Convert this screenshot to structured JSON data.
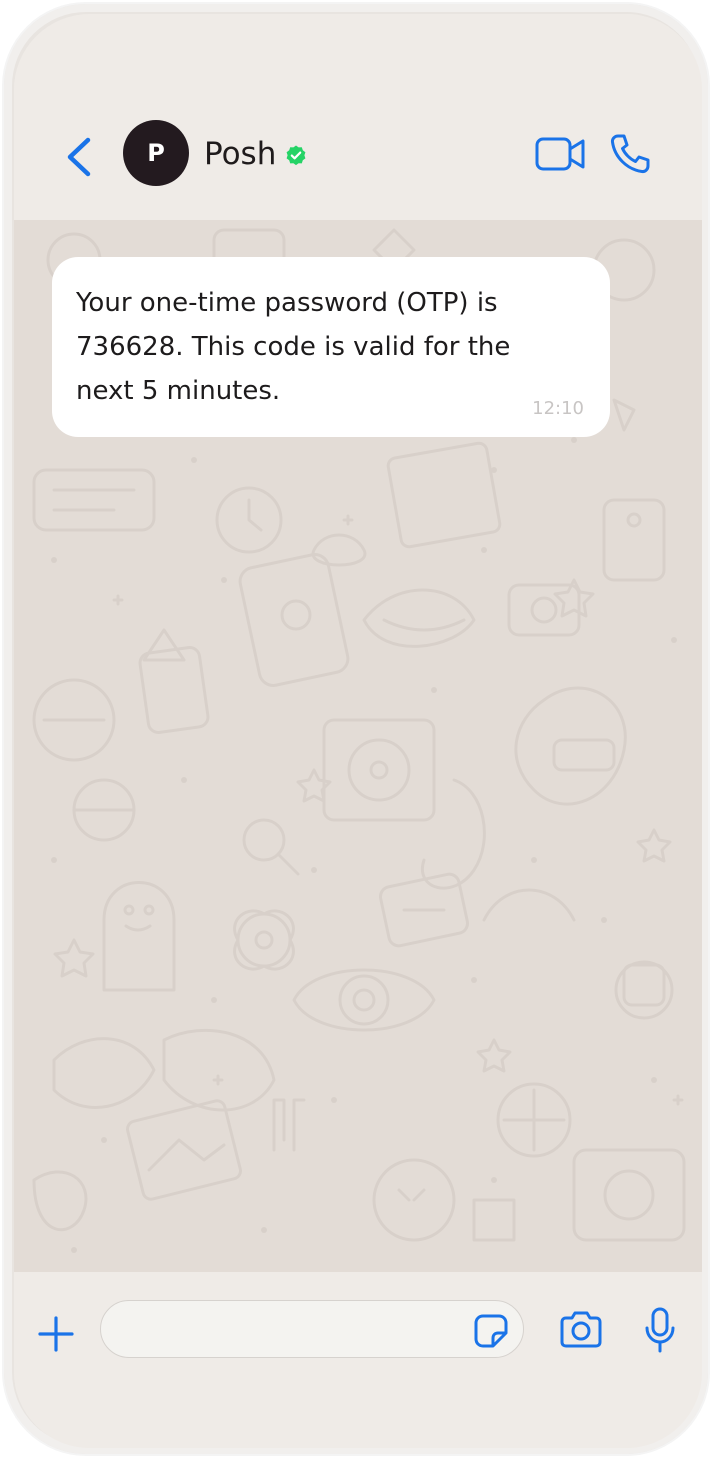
{
  "header": {
    "avatar_letter": "P",
    "contact_name": "Posh",
    "verified_icon": "verified-badge-icon",
    "back_icon": "chevron-left-icon",
    "video_icon": "video-camera-icon",
    "call_icon": "phone-icon"
  },
  "messages": [
    {
      "text": "Your one-time password (OTP) is 736628. This code is valid for the next 5 minutes.",
      "time": "12:10",
      "direction": "incoming"
    }
  ],
  "composer": {
    "input_value": "",
    "plus_icon": "plus-icon",
    "sticker_icon": "sticker-icon",
    "camera_icon": "camera-icon",
    "mic_icon": "microphone-icon"
  },
  "colors": {
    "accent": "#1a73e8",
    "verified": "#25d366",
    "avatar_bg": "#231a1f",
    "chat_bg": "#e3dcd6",
    "bubble_bg": "#ffffff"
  }
}
